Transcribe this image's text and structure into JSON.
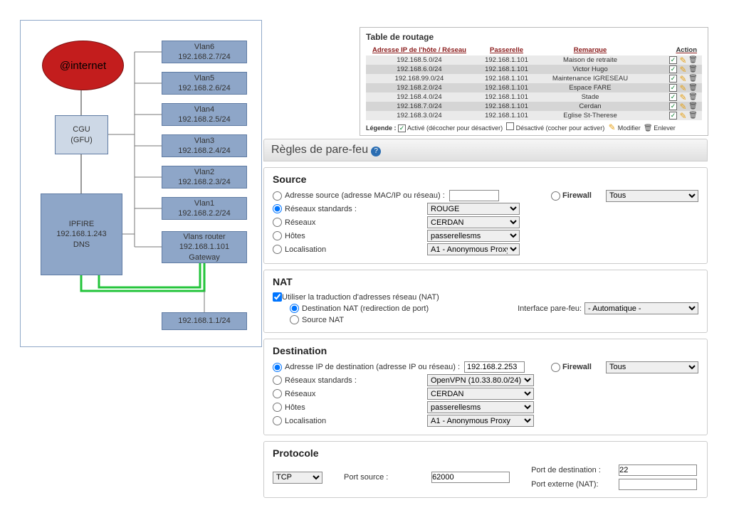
{
  "diagram": {
    "internet": "@internet",
    "cgu": "CGU\n(GFU)",
    "ipfire": "IPFIRE\n192.168.1.243\nDNS",
    "vlans": [
      {
        "name": "Vlan6",
        "ip": "192.168.2.7/24"
      },
      {
        "name": "Vlan5",
        "ip": "192.168.2.6/24"
      },
      {
        "name": "Vlan4",
        "ip": "192.168.2.5/24"
      },
      {
        "name": "Vlan3",
        "ip": "192.168.2.4/24"
      },
      {
        "name": "Vlan2",
        "ip": "192.168.2.3/24"
      },
      {
        "name": "Vlan1",
        "ip": "192.168.2.2/24"
      }
    ],
    "vrouter": "Vlans router\n192.168.1.101\nGateway",
    "net": "192.168.1.1/24"
  },
  "routing": {
    "title": "Table de routage",
    "headers": {
      "net": "Adresse IP de l'hôte / Réseau",
      "gw": "Passerelle",
      "rem": "Remarque",
      "act": "Action"
    },
    "rows": [
      {
        "net": "192.168.5.0/24",
        "gw": "192.168.1.101",
        "rem": "Maison de retraite"
      },
      {
        "net": "192.168.6.0/24",
        "gw": "192.168.1.101",
        "rem": "Victor Hugo"
      },
      {
        "net": "192.168.99.0/24",
        "gw": "192.168.1.101",
        "rem": "Maintenance IGRESEAU"
      },
      {
        "net": "192.168.2.0/24",
        "gw": "192.168.1.101",
        "rem": "Espace FARE"
      },
      {
        "net": "192.168.4.0/24",
        "gw": "192.168.1.101",
        "rem": "Stade"
      },
      {
        "net": "192.168.7.0/24",
        "gw": "192.168.1.101",
        "rem": "Cerdan"
      },
      {
        "net": "192.168.3.0/24",
        "gw": "192.168.1.101",
        "rem": "Eglise St-Therese"
      }
    ],
    "legend": {
      "label": "Légende :",
      "active": "Activé (décocher pour désactiver)",
      "inactive": "Désactivé (cocher pour activer)",
      "edit": "Modifier",
      "del": "Enlever"
    }
  },
  "fw": {
    "title": "Règles de pare-feu",
    "source": {
      "title": "Source",
      "addr": "Adresse source (adresse MAC/IP ou réseau) :",
      "firewall": "Firewall",
      "firewall_sel": "Tous",
      "std": "Réseaux standards :",
      "nets": "Réseaux",
      "hosts": "Hôtes",
      "loc": "Localisation",
      "std_sel": "ROUGE",
      "nets_sel": "CERDAN",
      "hosts_sel": "passerellesms",
      "loc_sel": "A1 - Anonymous Proxy"
    },
    "nat": {
      "title": "NAT",
      "use": "Utiliser la traduction d'adresses réseau (NAT)",
      "dnat": "Destination NAT (redirection de port)",
      "snat": "Source NAT",
      "iface": "Interface pare-feu:",
      "iface_sel": "- Automatique -"
    },
    "dest": {
      "title": "Destination",
      "addr": "Adresse IP de destination (adresse IP ou réseau) :",
      "addr_val": "192.168.2.253",
      "firewall": "Firewall",
      "firewall_sel": "Tous",
      "std": "Réseaux standards :",
      "nets": "Réseaux",
      "hosts": "Hôtes",
      "loc": "Localisation",
      "std_sel": "OpenVPN (10.33.80.0/24)",
      "nets_sel": "CERDAN",
      "hosts_sel": "passerellesms",
      "loc_sel": "A1 - Anonymous Proxy"
    },
    "proto": {
      "title": "Protocole",
      "sel": "TCP",
      "psrc": "Port source :",
      "psrc_val": "62000",
      "pdst": "Port de destination :",
      "pdst_val": "22",
      "pext": "Port externe (NAT):",
      "pext_val": ""
    }
  }
}
